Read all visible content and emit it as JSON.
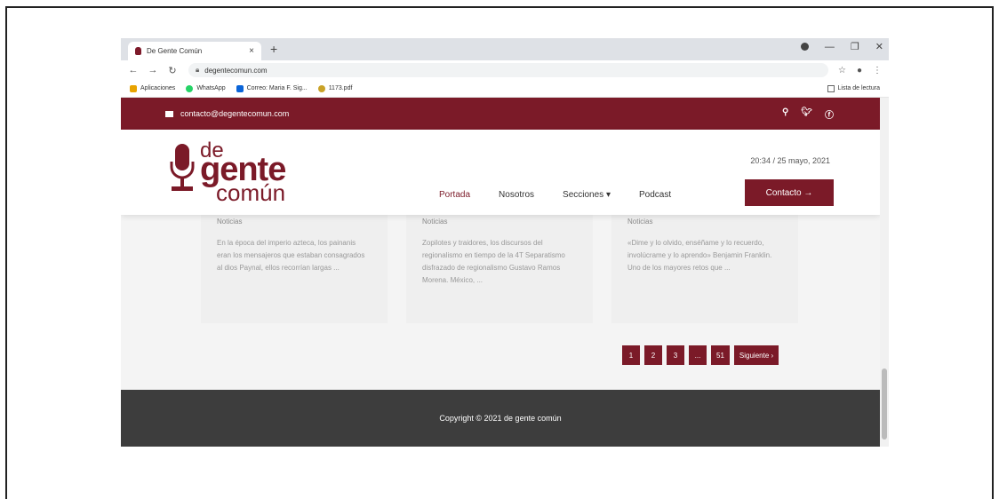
{
  "browser": {
    "tab_title": "De Gente Común",
    "tab_close": "×",
    "new_tab": "+",
    "url": "degentecomun.com",
    "bookmarks": [
      {
        "label": "Aplicaciones",
        "color": "#e8a300"
      },
      {
        "label": "WhatsApp",
        "color": "#25d366"
      },
      {
        "label": "Correo: Maria F. Sig...",
        "color": "#0a64d8"
      },
      {
        "label": "1173.pdf",
        "color": "#c9a227"
      }
    ],
    "reading_list": "Lista de lectura"
  },
  "topbar": {
    "email": "contacto@degentecomun.com",
    "icons": [
      "search-icon",
      "twitter-icon",
      "facebook-icon"
    ]
  },
  "header": {
    "logo": {
      "line1": "de",
      "line2": "gente",
      "line3": "común"
    },
    "datetime": "20:34 / 25 mayo, 2021",
    "menu": [
      {
        "label": "Portada",
        "active": true
      },
      {
        "label": "Nosotros"
      },
      {
        "label": "Secciones ▾"
      },
      {
        "label": "Podcast"
      }
    ],
    "contact_button": "Contacto →"
  },
  "cards": [
    {
      "category": "Noticias",
      "excerpt": "En la época del imperio azteca, los painanis eran los mensajeros que estaban consagrados al dios Paynal, ellos recorrían largas ..."
    },
    {
      "category": "Noticias",
      "excerpt": "Zopilotes y traidores, los discursos del regionalismo en tiempo de la 4T Separatismo disfrazado de regionalismo Gustavo Ramos Morena. México, ..."
    },
    {
      "category": "Noticias",
      "excerpt": "«Dime y lo olvido, enséñame y lo recuerdo, involúcrame y lo aprendo» Benjamin Franklin. Uno de los mayores retos que ..."
    }
  ],
  "pagination": [
    "1",
    "2",
    "3",
    "...",
    "51",
    "Siguiente ›"
  ],
  "footer": {
    "copyright": "Copyright © 2021 de gente común"
  },
  "colors": {
    "brand": "#7b1a28",
    "footer": "#3d3d3d"
  }
}
